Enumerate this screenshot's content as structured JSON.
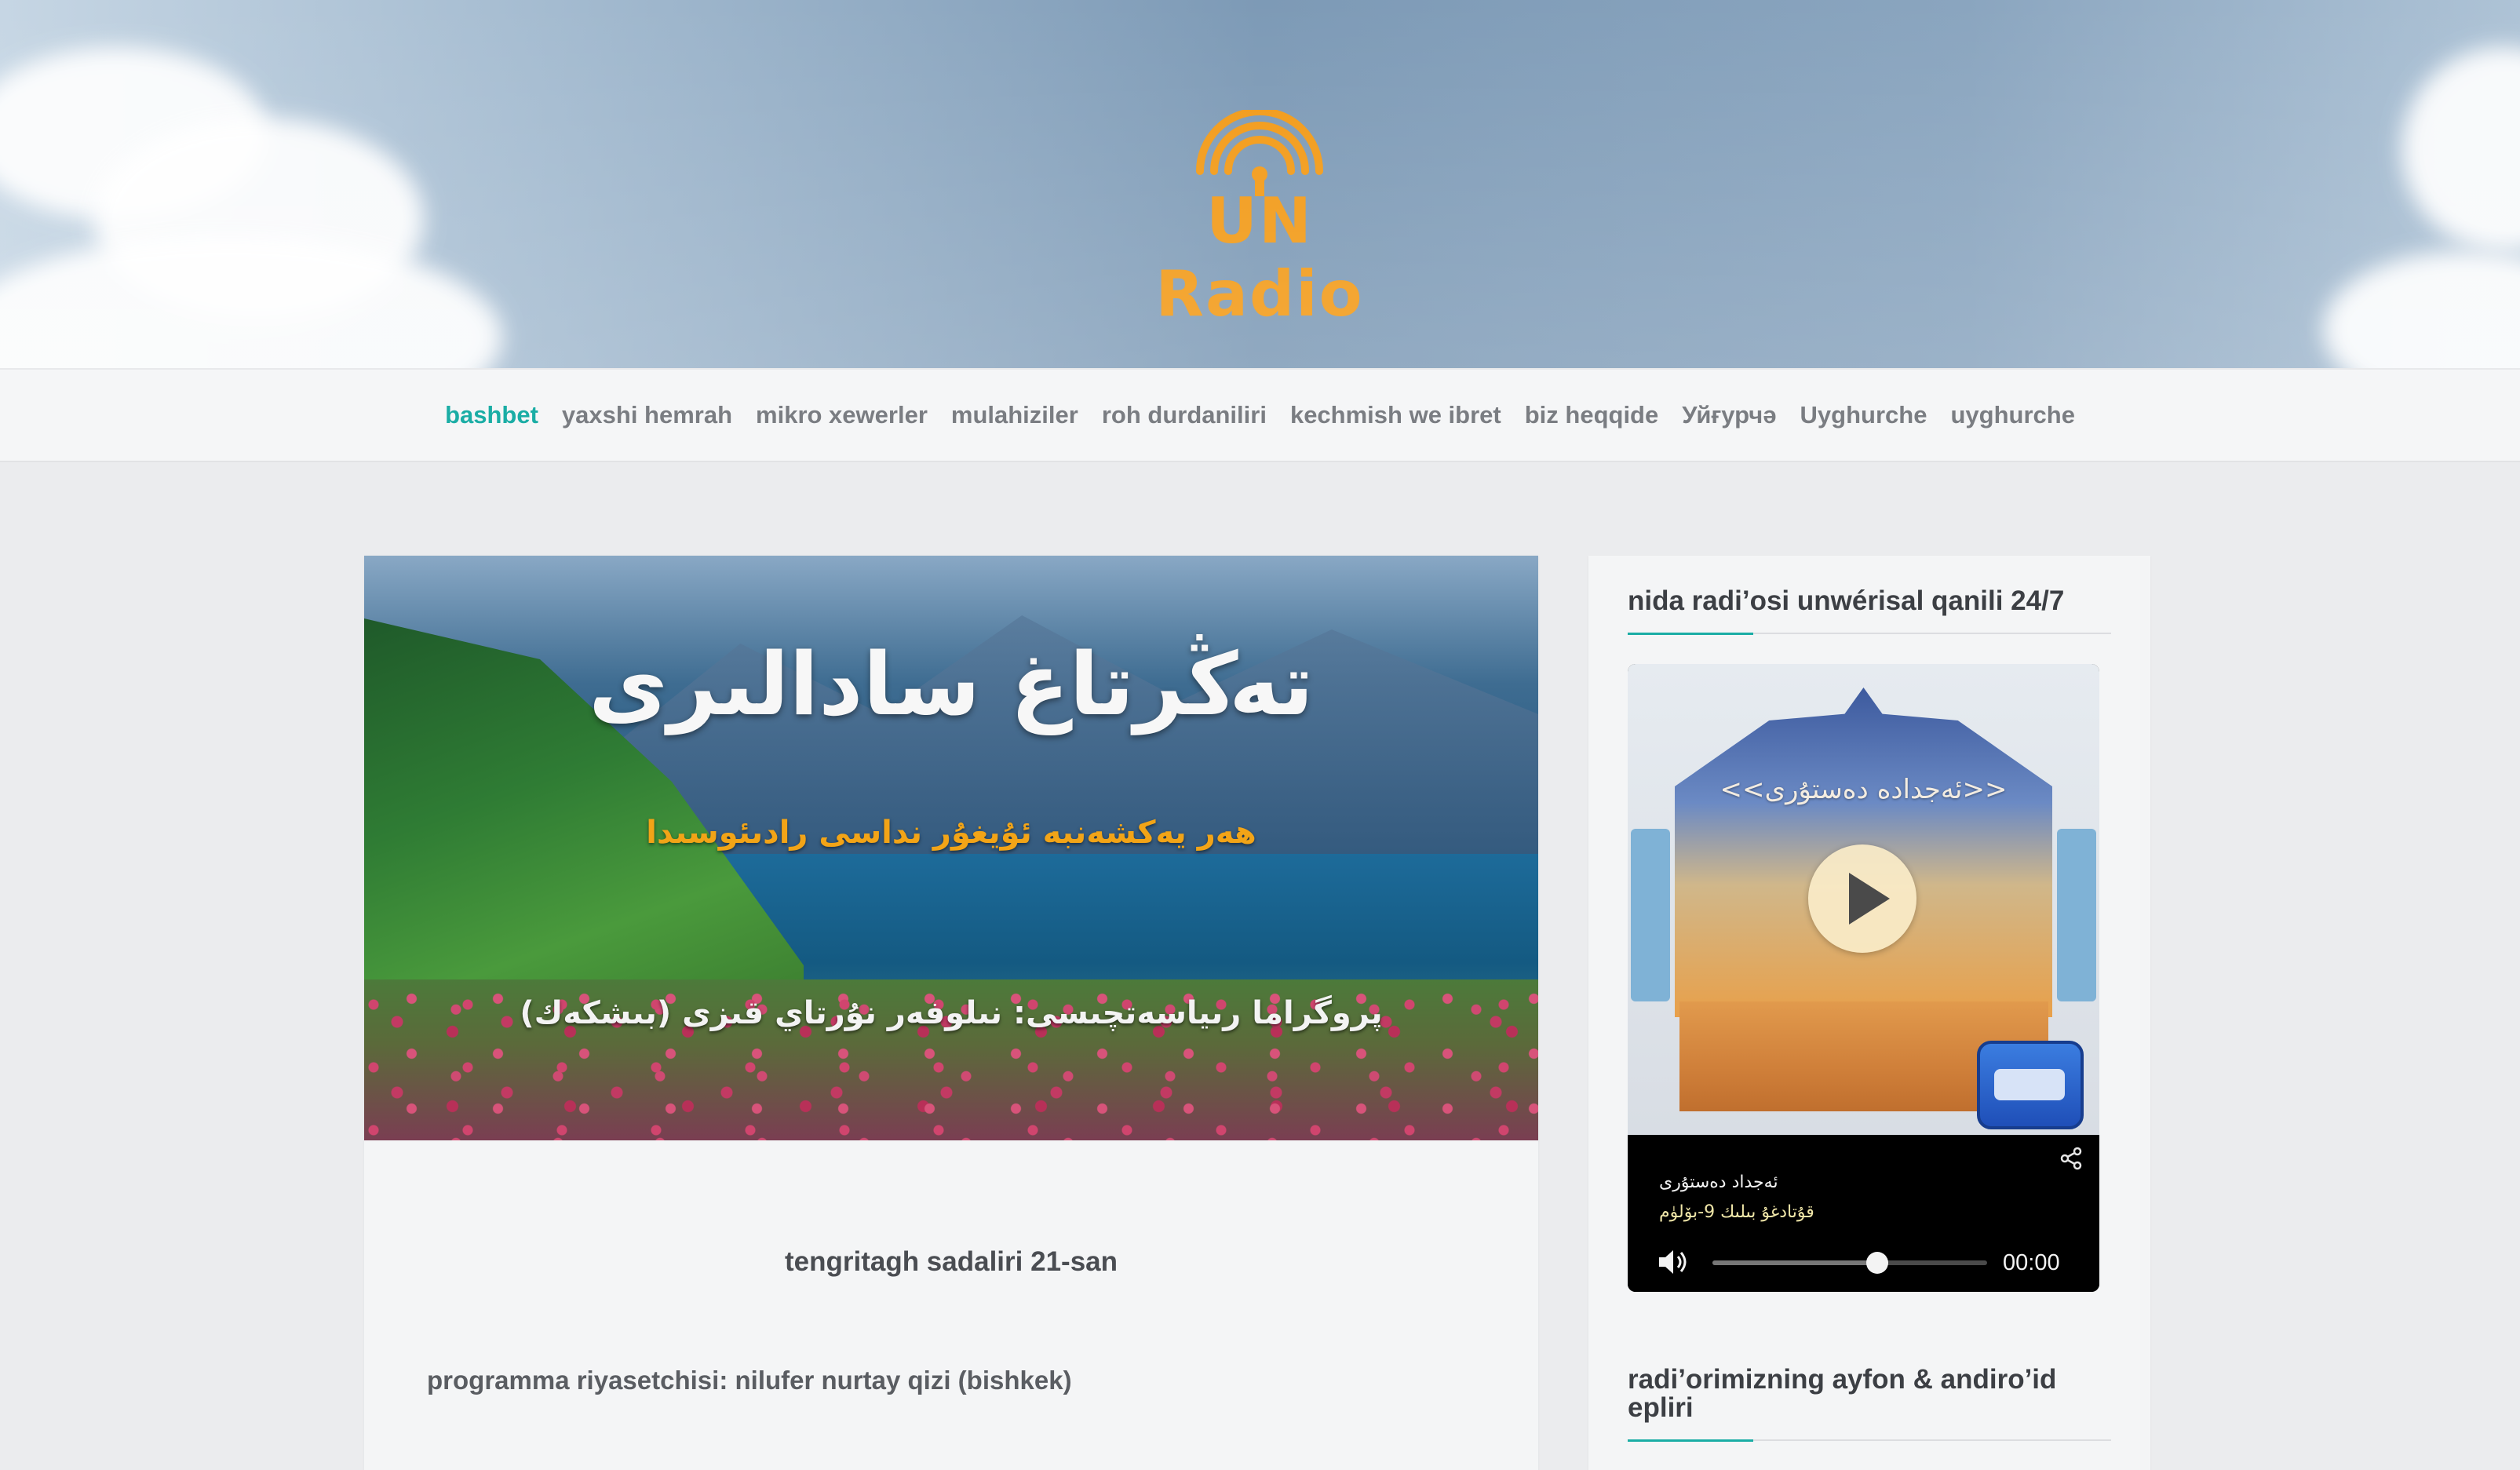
{
  "brand": {
    "logo_text": "UN Radio",
    "accent": "#f29a17"
  },
  "nav": {
    "items": [
      {
        "label": "bashbet",
        "active": true
      },
      {
        "label": "yaxshi hemrah"
      },
      {
        "label": "mikro xewerler"
      },
      {
        "label": "mulahiziler"
      },
      {
        "label": "roh durdaniliri"
      },
      {
        "label": "kechmish we ibret"
      },
      {
        "label": "biz heqqide"
      },
      {
        "label": "Уйғурчә"
      },
      {
        "label": "Uyghurche"
      },
      {
        "label": "uyghurche"
      }
    ],
    "active_color": "#1aada5"
  },
  "post": {
    "hero_title": "تەڭرتاغ سادالىرى",
    "hero_subtitle": "ھەر يەكشەنبە ئۇيغۇر نداسى رادىئوسىدا",
    "hero_host": "پروگراما رىياسەتچىسى: نىلوفەر نۇرتاي قىزى (بىشكەك)",
    "title": "tengritagh sadaliri 21-san",
    "body": "programma riyasetchisi: nilufer nurtay qizi (bishkek)"
  },
  "sidebar": {
    "widget1_title": "nida radi’osi unwérisal qanili 24/7",
    "widget2_title": "radi’orimizning ayfon & andiro’id epliri",
    "player": {
      "art_text": "<<ئەجدادە دەستۇرى>>",
      "track_title": "ئەجداد دەستۇرى",
      "track_subtitle": "قۇتادغۇ بىلىك 9-بۆلۈم",
      "time": "00:00",
      "progress": 0.6
    }
  }
}
